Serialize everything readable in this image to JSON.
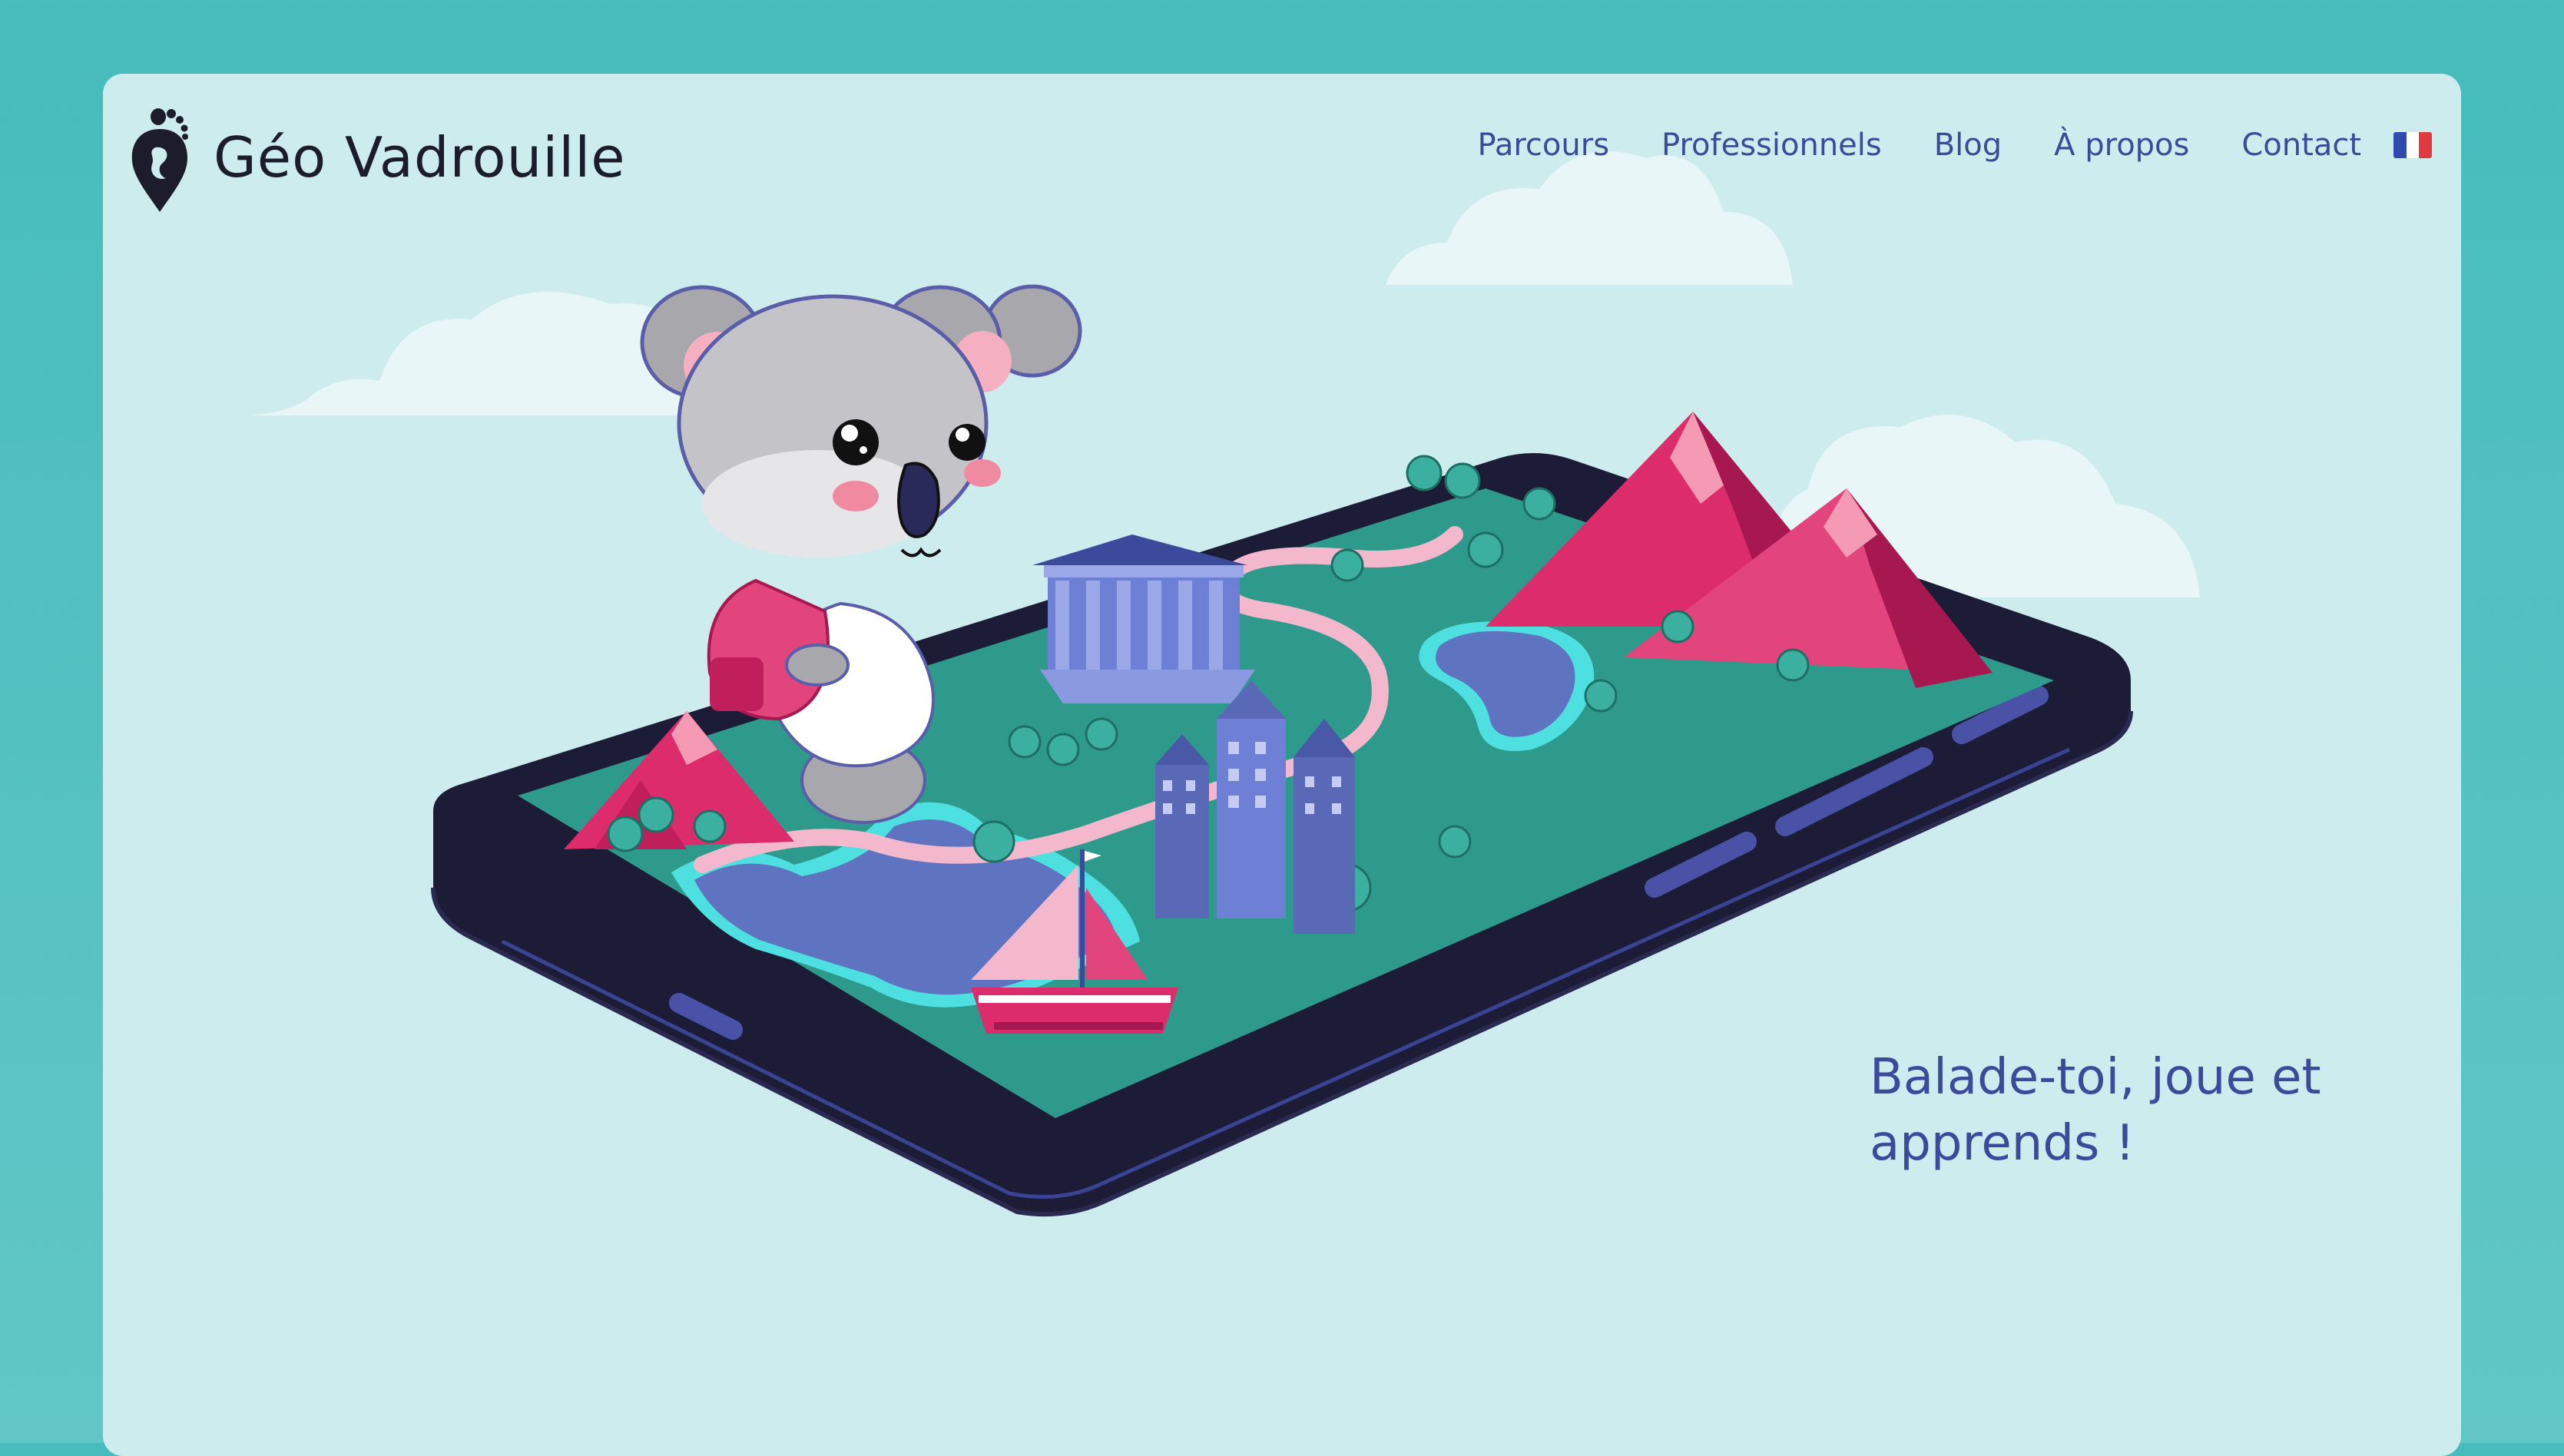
{
  "header": {
    "brand": "Géo Vadrouille",
    "logo_icon": "footprint-pin-icon"
  },
  "nav": {
    "items": [
      {
        "label": "Parcours"
      },
      {
        "label": "Professionnels"
      },
      {
        "label": "Blog"
      },
      {
        "label": "À propos"
      },
      {
        "label": "Contact"
      }
    ],
    "language_icon": "french-flag-icon"
  },
  "hero": {
    "tagline": "Balade-toi, joue et apprends !",
    "illustration": "koala-walking-on-phone-map-illustration"
  },
  "colors": {
    "outer_bg": "#46bcbc",
    "card_bg": "#cdeced",
    "nav_text": "#3c4a9c",
    "brand_text": "#1c1c2c",
    "phone_body": "#1c1c36",
    "map_green": "#2e9a8c",
    "mountain_pink": "#dc2c6c",
    "water_blue": "#5e74c0"
  }
}
